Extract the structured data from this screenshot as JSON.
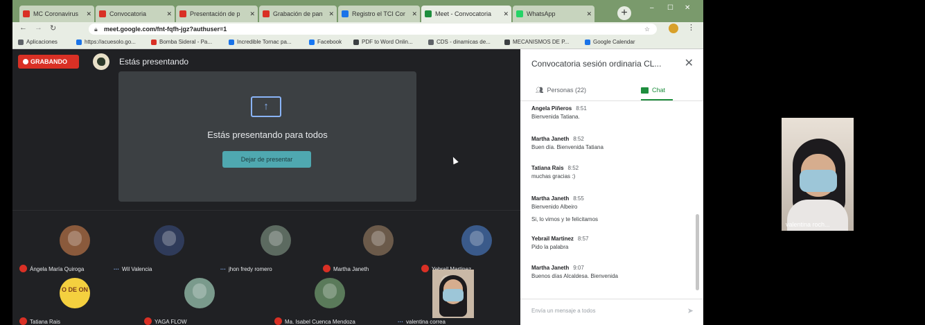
{
  "browser": {
    "tabs": [
      {
        "label": "MC Coronavirus",
        "color": "#d93025"
      },
      {
        "label": "Convocatoria",
        "color": "#d93025"
      },
      {
        "label": "Presentación de p",
        "color": "#d93025"
      },
      {
        "label": "Grabación de pan",
        "color": "#d93025"
      },
      {
        "label": "Registro el TCI Cor",
        "color": "#1a73e8"
      },
      {
        "label": "Meet - Convocatoria",
        "color": "#1e8e3e",
        "active": true
      },
      {
        "label": "WhatsApp",
        "color": "#25d366"
      }
    ],
    "new_tab": "+",
    "url": "meet.google.com/fnt-fqfh-jgz?authuser=1",
    "bookmarks": [
      {
        "label": "Aplicaciones",
        "color": "#5f6368"
      },
      {
        "label": "https://acuesolo.go...",
        "color": "#1a73e8"
      },
      {
        "label": "Bomba Sideral - Pa...",
        "color": "#d93025"
      },
      {
        "label": "Incredible Tornac pa...",
        "color": "#1a73e8"
      },
      {
        "label": "Facebook",
        "color": "#1877f2"
      },
      {
        "label": "PDF to Word Onlin...",
        "color": "#3c4043"
      },
      {
        "label": "CDS - dinamicas de...",
        "color": "#5f6368"
      },
      {
        "label": "MECANISMOS DE P...",
        "color": "#3c4043"
      },
      {
        "label": "Google Calendar",
        "color": "#1a73e8"
      }
    ]
  },
  "meet": {
    "recording_label": "GRABANDO",
    "presenting_label": "Estás presentando",
    "presenting_message": "Estás presentando para todos",
    "stop_button": "Dejar de presentar",
    "participants": [
      {
        "name": "Ángela María Quiroga",
        "muted": true,
        "avatar_color": "#8a5a3c"
      },
      {
        "name": "Wil Valencia",
        "muted": false,
        "avatar_color": "#2f3b5a"
      },
      {
        "name": "jhon fredy romero",
        "muted": false,
        "avatar_color": "#5c6a60"
      },
      {
        "name": "Martha Janeth",
        "muted": true,
        "avatar_color": "#6b5a4a"
      },
      {
        "name": "Yebrail Martinez",
        "muted": true,
        "avatar_color": "#3a5a8a"
      },
      {
        "name": "Tatiana Rais",
        "muted": true,
        "avatar_color": "#f4d03f"
      },
      {
        "name": "YAGA FLOW",
        "muted": true,
        "avatar_color": "#7a9a8c"
      },
      {
        "name": "Ma. Isabel Cuenca Mendoza",
        "muted": true,
        "avatar_color": "#5a7a5a"
      },
      {
        "name": "valentina correa",
        "muted": false,
        "avatar_color": "#c9b8a6"
      }
    ],
    "tatiana_logo_text": "O DE ON"
  },
  "chat": {
    "title": "Convocatoria sesión ordinaria CL...",
    "tab_people": "Personas (22)",
    "tab_chat": "Chat",
    "messages": [
      {
        "author": "Angela Piñeros",
        "time": "8:51",
        "text": "Bienvenida Tatiana."
      },
      {
        "author": "Martha Janeth",
        "time": "8:52",
        "text": "Buen día. Bienvenida Tatiana"
      },
      {
        "author": "Tatiana Rais",
        "time": "8:52",
        "text": "muchas gracias :)"
      },
      {
        "author": "Martha Janeth",
        "time": "8:55",
        "text": "Bienvenido Albeiro"
      },
      {
        "author": "",
        "time": "",
        "text": "Si, lo vimos y te felicitamos"
      },
      {
        "author": "Yebrail Martinez",
        "time": "8:57",
        "text": "Pido la palabra"
      },
      {
        "author": "Martha Janeth",
        "time": "9:07",
        "text": "Buenos días Alcaldesa. Bienvenida"
      }
    ],
    "composer_placeholder": "Envía un mensaje a todos",
    "send_icon": "➤"
  },
  "selfview": {
    "label": "valentina roch..."
  }
}
